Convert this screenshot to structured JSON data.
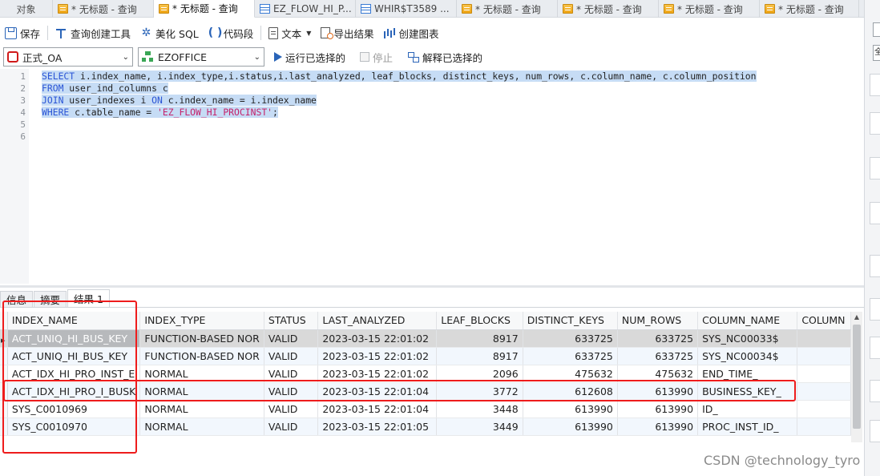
{
  "tabs": [
    {
      "label": "对象",
      "icon": "none",
      "active": false
    },
    {
      "label": "* 无标题 - 查询",
      "icon": "query-icon",
      "active": false
    },
    {
      "label": "* 无标题 - 查询",
      "icon": "query-icon",
      "active": true
    },
    {
      "label": "EZ_FLOW_HI_P...",
      "icon": "table-icon",
      "active": false
    },
    {
      "label": "WHIR$T3589 ...",
      "icon": "table-icon",
      "active": false
    },
    {
      "label": "* 无标题 - 查询",
      "icon": "query-icon",
      "active": false
    },
    {
      "label": "* 无标题 - 查询",
      "icon": "query-icon",
      "active": false
    },
    {
      "label": "* 无标题 - 查询",
      "icon": "query-icon",
      "active": false
    },
    {
      "label": "* 无标题 - 查询",
      "icon": "query-icon",
      "active": false
    }
  ],
  "toolbar": {
    "save": "保存",
    "query_builder": "查询创建工具",
    "beautify": "美化 SQL",
    "snippet": "代码段",
    "text": "文本",
    "export": "导出结果",
    "create_chart": "创建图表"
  },
  "toolbar2": {
    "connection": "正式_OA",
    "schema": "EZOFFICE",
    "run_selected": "运行已选择的",
    "stop": "停止",
    "explain_selected": "解释已选择的"
  },
  "editor": {
    "line_numbers": [
      "1",
      "2",
      "3",
      "4",
      "5",
      "6"
    ],
    "lines": [
      [
        {
          "t": "SELECT",
          "c": "kw"
        },
        {
          "t": " i.index_name, i.index_type,i.status,i.last_analyzed, leaf_blocks, distinct_keys, num_rows, c.column_name, c.column_position",
          "c": ""
        }
      ],
      [
        {
          "t": "FROM",
          "c": "kw"
        },
        {
          "t": " user_ind_columns c",
          "c": ""
        }
      ],
      [
        {
          "t": "JOIN",
          "c": "kw"
        },
        {
          "t": " user_indexes i ",
          "c": ""
        },
        {
          "t": "ON",
          "c": "kw"
        },
        {
          "t": " c.index_name = i.index_name",
          "c": ""
        }
      ],
      [
        {
          "t": "WHERE",
          "c": "kw"
        },
        {
          "t": " c.table_name = ",
          "c": ""
        },
        {
          "t": "'EZ_FLOW_HI_PROCINST'",
          "c": "str"
        },
        {
          "t": ";",
          "c": ""
        }
      ]
    ]
  },
  "result_tabs": [
    "信息",
    "摘要",
    "结果 1"
  ],
  "grid": {
    "columns": [
      "INDEX_NAME",
      "INDEX_TYPE",
      "STATUS",
      "LAST_ANALYZED",
      "LEAF_BLOCKS",
      "DISTINCT_KEYS",
      "NUM_ROWS",
      "COLUMN_NAME",
      "COLUMN"
    ],
    "rows": [
      [
        "ACT_UNIQ_HI_BUS_KEY",
        "FUNCTION-BASED NOR",
        "VALID",
        "2023-03-15 22:01:02",
        "8917",
        "633725",
        "633725",
        "SYS_NC00033$",
        ""
      ],
      [
        "ACT_UNIQ_HI_BUS_KEY",
        "FUNCTION-BASED NOR",
        "VALID",
        "2023-03-15 22:01:02",
        "8917",
        "633725",
        "633725",
        "SYS_NC00034$",
        ""
      ],
      [
        "ACT_IDX_HI_PRO_INST_E",
        "NORMAL",
        "VALID",
        "2023-03-15 22:01:02",
        "2096",
        "475632",
        "475632",
        "END_TIME_",
        ""
      ],
      [
        "ACT_IDX_HI_PRO_I_BUSK",
        "NORMAL",
        "VALID",
        "2023-03-15 22:01:04",
        "3772",
        "612608",
        "613990",
        "BUSINESS_KEY_",
        ""
      ],
      [
        "SYS_C0010969",
        "NORMAL",
        "VALID",
        "2023-03-15 22:01:04",
        "3448",
        "613990",
        "613990",
        "ID_",
        ""
      ],
      [
        "SYS_C0010970",
        "NORMAL",
        "VALID",
        "2023-03-15 22:01:05",
        "3449",
        "613990",
        "613990",
        "PROC_INST_ID_",
        ""
      ]
    ]
  },
  "right_panel": {
    "input_partial": "全"
  },
  "watermark": "CSDN @technology_tyro",
  "colors": {
    "annotation": "#ee1c1c",
    "keyword": "#2b55d6",
    "string": "#c4226b",
    "selection": "#c6dcf5"
  }
}
